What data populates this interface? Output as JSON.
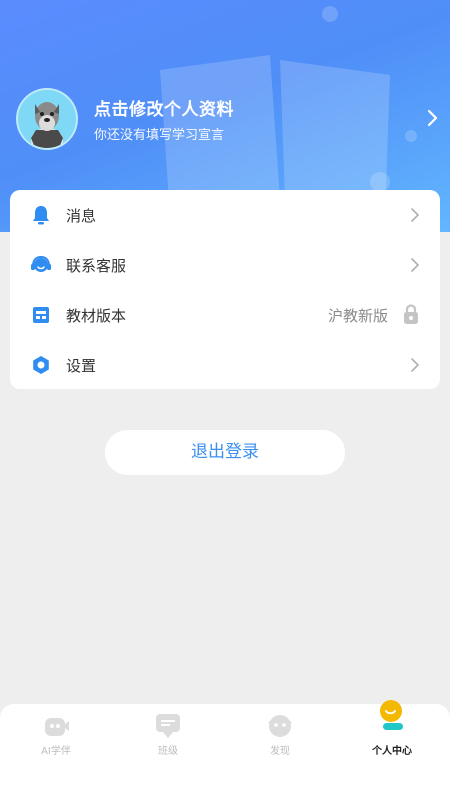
{
  "profile": {
    "title": "点击修改个人资料",
    "subtitle": "你还没有填写学习宣言"
  },
  "menu": [
    {
      "label": "消息",
      "icon": "bell-icon",
      "value": "",
      "trailing": "chevron"
    },
    {
      "label": "联系客服",
      "icon": "headset-icon",
      "value": "",
      "trailing": "chevron"
    },
    {
      "label": "教材版本",
      "icon": "book-icon",
      "value": "沪教新版",
      "trailing": "lock"
    },
    {
      "label": "设置",
      "icon": "gear-icon",
      "value": "",
      "trailing": "chevron"
    }
  ],
  "logout_label": "退出登录",
  "nav": [
    {
      "label": "AI学伴",
      "icon": "ai-companion-icon",
      "active": false
    },
    {
      "label": "班级",
      "icon": "class-icon",
      "active": false
    },
    {
      "label": "发现",
      "icon": "discover-icon",
      "active": false
    },
    {
      "label": "个人中心",
      "icon": "profile-center-icon",
      "active": true
    }
  ],
  "colors": {
    "accent": "#3b8ff0",
    "header_start": "#5b8cff",
    "header_end": "#62b6ff",
    "nav_active_icon": "#f5b800",
    "nav_active_teal": "#1fc7c7"
  }
}
